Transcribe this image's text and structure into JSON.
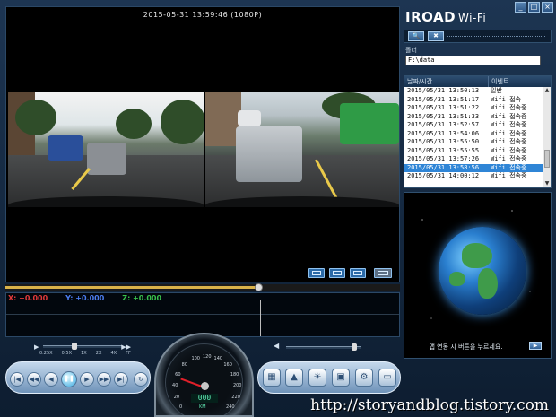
{
  "app": {
    "brand": "IROAD",
    "brand_suffix": "Wi-Fi",
    "window_buttons": [
      "_",
      "□",
      "×"
    ]
  },
  "video": {
    "timestamp": "2015-05-31 13:59:46 (1080P)"
  },
  "timeline": {
    "progress": 0.64
  },
  "gsensor": {
    "x_label": "X: +0.000",
    "y_label": "Y: +0.000",
    "z_label": "Z: +0.000",
    "colors": {
      "x": "#e23a3a",
      "y": "#4c7ef0",
      "z": "#39c24c"
    }
  },
  "folder": {
    "label": "폴더",
    "path": "F:\\data"
  },
  "filelist": {
    "headers": [
      "날짜/시간",
      "이벤트"
    ],
    "rows": [
      {
        "date": "2015/05/31 13:50:13",
        "event": "일반"
      },
      {
        "date": "2015/05/31 13:51:17",
        "event": "Wifi 접속"
      },
      {
        "date": "2015/05/31 13:51:22",
        "event": "Wifi 접속중"
      },
      {
        "date": "2015/05/31 13:51:33",
        "event": "Wifi 접속중"
      },
      {
        "date": "2015/05/31 13:52:57",
        "event": "Wifi 접속중"
      },
      {
        "date": "2015/05/31 13:54:06",
        "event": "Wifi 접속중"
      },
      {
        "date": "2015/05/31 13:55:50",
        "event": "Wifi 접속중"
      },
      {
        "date": "2015/05/31 13:55:55",
        "event": "Wifi 접속중"
      },
      {
        "date": "2015/05/31 13:57:26",
        "event": "Wifi 접속중"
      },
      {
        "date": "2015/05/31 13:58:56",
        "event": "Wifi 접속중",
        "selected": true
      },
      {
        "date": "2015/05/31 14:00:12",
        "event": "Wifi 접속중"
      }
    ]
  },
  "map": {
    "message": "맵 연동 시 버튼을 누르세요."
  },
  "playback": {
    "speed_ticks": [
      "0.25X",
      "0.5X",
      "1X",
      "2X",
      "4X",
      "FF"
    ],
    "speed_value": "1X",
    "volume": 0.88
  },
  "speedometer": {
    "ticks": [
      "0",
      "20",
      "40",
      "60",
      "80",
      "100",
      "120",
      "140",
      "160",
      "180",
      "200",
      "220",
      "240"
    ],
    "digital": "000",
    "unit": "KM"
  },
  "watermark": "http://storyandblog.tistory.com"
}
